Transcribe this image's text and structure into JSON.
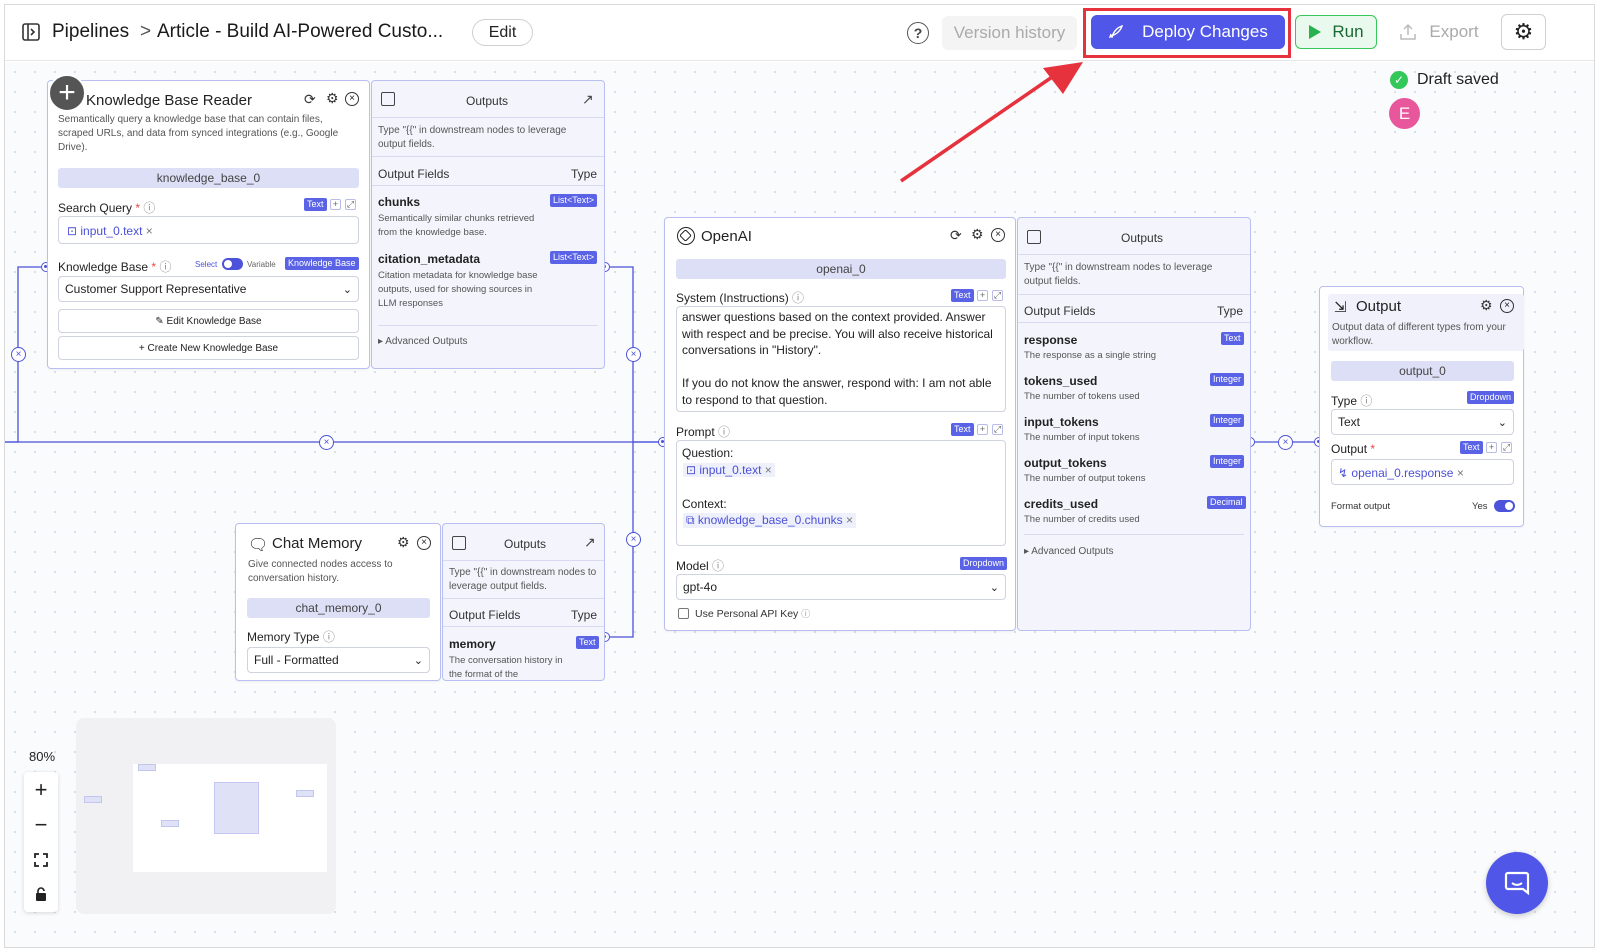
{
  "topbar": {
    "breadcrumb_root": "Pipelines",
    "breadcrumb_sep": ">",
    "title": "Article - Build AI-Powered Custo...",
    "edit_label": "Edit",
    "version_history": "Version history",
    "deploy_label": "Deploy Changes",
    "run_label": "Run",
    "export_label": "Export"
  },
  "status": {
    "draft": "Draft saved",
    "avatar_letter": "E"
  },
  "kb_node": {
    "title": "Knowledge Base Reader",
    "description": "Semantically query a knowledge base that can contain files, scraped URLs, and data from synced integrations (e.g., Google Drive).",
    "id": "knowledge_base_0",
    "search_label": "Search Query",
    "search_type": "Text",
    "search_chip": "input_0.text",
    "kb_label": "Knowledge Base",
    "toggle_select": "Select",
    "toggle_variable": "Variable",
    "kb_type": "Knowledge Base",
    "kb_value": "Customer Support Representative",
    "edit_kb": "Edit Knowledge Base",
    "create_kb": "Create New Knowledge Base"
  },
  "kb_outputs": {
    "header": "Outputs",
    "hint": "Type \"{{\" in downstream nodes to leverage output fields.",
    "col_fields": "Output Fields",
    "col_type": "Type",
    "fields": [
      {
        "name": "chunks",
        "type": "List<Text>",
        "desc": "Semantically similar chunks retrieved from the knowledge base."
      },
      {
        "name": "citation_metadata",
        "type": "List<Text>",
        "desc": "Citation metadata for knowledge base outputs, used for showing sources in LLM responses"
      }
    ],
    "advanced": "Advanced Outputs"
  },
  "chat_node": {
    "title": "Chat Memory",
    "description": "Give connected nodes access to conversation history.",
    "id": "chat_memory_0",
    "memtype_label": "Memory Type",
    "memtype_value": "Full - Formatted"
  },
  "chat_outputs": {
    "header": "Outputs",
    "hint": "Type \"{{\" in downstream nodes to leverage output fields.",
    "col_fields": "Output Fields",
    "col_type": "Type",
    "field_name": "memory",
    "field_type": "Text",
    "field_desc": "The conversation history in the format of the"
  },
  "openai_node": {
    "title": "OpenAI",
    "id": "openai_0",
    "system_label": "System (Instructions)",
    "system_type": "Text",
    "system_text_1": "answer questions based on the context provided. Answer with respect and be precise. You will also receive historical conversations in \"History\".",
    "system_text_2": "If you do not know the answer, respond with: I am not able to respond to that question.",
    "prompt_label": "Prompt",
    "prompt_type": "Text",
    "prompt_question": "Question:",
    "prompt_chip1": "input_0.text",
    "prompt_context": "Context:",
    "prompt_chip2": "knowledge_base_0.chunks",
    "model_label": "Model",
    "model_type": "Dropdown",
    "model_value": "gpt-4o",
    "api_key_label": "Use Personal API Key"
  },
  "openai_outputs": {
    "header": "Outputs",
    "hint": "Type \"{{\" in downstream nodes to leverage output fields.",
    "col_fields": "Output Fields",
    "col_type": "Type",
    "fields": [
      {
        "name": "response",
        "type": "Text",
        "desc": "The response as a single string"
      },
      {
        "name": "tokens_used",
        "type": "Integer",
        "desc": "The number of tokens used"
      },
      {
        "name": "input_tokens",
        "type": "Integer",
        "desc": "The number of input tokens"
      },
      {
        "name": "output_tokens",
        "type": "Integer",
        "desc": "The number of output tokens"
      },
      {
        "name": "credits_used",
        "type": "Decimal",
        "desc": "The number of credits used"
      }
    ],
    "advanced": "Advanced Outputs"
  },
  "output_node": {
    "title": "Output",
    "description": "Output data of different types from your workflow.",
    "id": "output_0",
    "type_label": "Type",
    "type_tag": "Dropdown",
    "type_value": "Text",
    "output_label": "Output",
    "output_tag": "Text",
    "output_chip": "openai_0.response",
    "format_label": "Format output",
    "format_yes": "Yes"
  },
  "zoom": {
    "level": "80%"
  },
  "colors": {
    "accent": "#5a63e6",
    "deploy_bg": "#4f56e8",
    "highlight": "#e5323d",
    "run_bg": "#e9f9ee",
    "run_border": "#34c759"
  }
}
